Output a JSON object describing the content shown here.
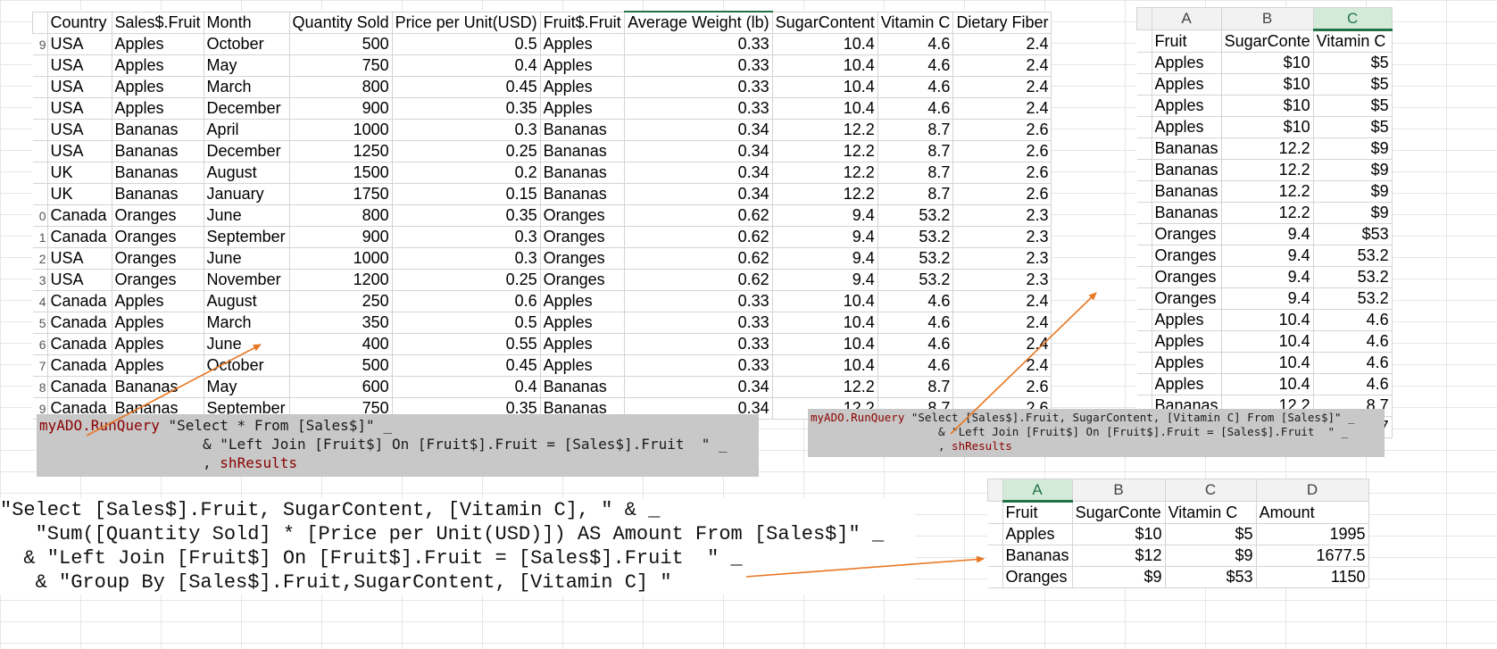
{
  "sales_table": {
    "headers": [
      "Country",
      "Sales$.Fruit",
      "Month",
      "Quantity Sold",
      "Price per Unit(USD)",
      "Fruit$.Fruit",
      "Average Weight (lb)",
      "SugarContent",
      "Vitamin C",
      "Dietary Fiber"
    ],
    "row_numbers": [
      "9",
      "",
      "",
      "",
      "",
      "",
      "",
      "",
      "0",
      "1",
      "2",
      "3",
      "4",
      "5",
      "6",
      "7",
      "8",
      "9"
    ],
    "rows": [
      [
        "USA",
        "Apples",
        "October",
        "500",
        "0.5",
        "Apples",
        "0.33",
        "10.4",
        "4.6",
        "2.4"
      ],
      [
        "USA",
        "Apples",
        "May",
        "750",
        "0.4",
        "Apples",
        "0.33",
        "10.4",
        "4.6",
        "2.4"
      ],
      [
        "USA",
        "Apples",
        "March",
        "800",
        "0.45",
        "Apples",
        "0.33",
        "10.4",
        "4.6",
        "2.4"
      ],
      [
        "USA",
        "Apples",
        "December",
        "900",
        "0.35",
        "Apples",
        "0.33",
        "10.4",
        "4.6",
        "2.4"
      ],
      [
        "USA",
        "Bananas",
        "April",
        "1000",
        "0.3",
        "Bananas",
        "0.34",
        "12.2",
        "8.7",
        "2.6"
      ],
      [
        "USA",
        "Bananas",
        "December",
        "1250",
        "0.25",
        "Bananas",
        "0.34",
        "12.2",
        "8.7",
        "2.6"
      ],
      [
        "UK",
        "Bananas",
        "August",
        "1500",
        "0.2",
        "Bananas",
        "0.34",
        "12.2",
        "8.7",
        "2.6"
      ],
      [
        "UK",
        "Bananas",
        "January",
        "1750",
        "0.15",
        "Bananas",
        "0.34",
        "12.2",
        "8.7",
        "2.6"
      ],
      [
        "Canada",
        "Oranges",
        "June",
        "800",
        "0.35",
        "Oranges",
        "0.62",
        "9.4",
        "53.2",
        "2.3"
      ],
      [
        "Canada",
        "Oranges",
        "September",
        "900",
        "0.3",
        "Oranges",
        "0.62",
        "9.4",
        "53.2",
        "2.3"
      ],
      [
        "USA",
        "Oranges",
        "June",
        "1000",
        "0.3",
        "Oranges",
        "0.62",
        "9.4",
        "53.2",
        "2.3"
      ],
      [
        "USA",
        "Oranges",
        "November",
        "1200",
        "0.25",
        "Oranges",
        "0.62",
        "9.4",
        "53.2",
        "2.3"
      ],
      [
        "Canada",
        "Apples",
        "August",
        "250",
        "0.6",
        "Apples",
        "0.33",
        "10.4",
        "4.6",
        "2.4"
      ],
      [
        "Canada",
        "Apples",
        "March",
        "350",
        "0.5",
        "Apples",
        "0.33",
        "10.4",
        "4.6",
        "2.4"
      ],
      [
        "Canada",
        "Apples",
        "June",
        "400",
        "0.55",
        "Apples",
        "0.33",
        "10.4",
        "4.6",
        "2.4"
      ],
      [
        "Canada",
        "Apples",
        "October",
        "500",
        "0.45",
        "Apples",
        "0.33",
        "10.4",
        "4.6",
        "2.4"
      ],
      [
        "Canada",
        "Bananas",
        "May",
        "600",
        "0.4",
        "Bananas",
        "0.34",
        "12.2",
        "8.7",
        "2.6"
      ],
      [
        "Canada",
        "Bananas",
        "September",
        "750",
        "0.35",
        "Bananas",
        "0.34",
        "12.2",
        "8.7",
        "2.6"
      ]
    ]
  },
  "subset_table": {
    "col_letters": [
      "A",
      "B",
      "C"
    ],
    "headers": [
      "Fruit",
      "SugarConte",
      "Vitamin C"
    ],
    "rows": [
      [
        "Apples",
        "$10",
        "$5"
      ],
      [
        "Apples",
        "$10",
        "$5"
      ],
      [
        "Apples",
        "$10",
        "$5"
      ],
      [
        "Apples",
        "$10",
        "$5"
      ],
      [
        "Bananas",
        "12.2",
        "$9"
      ],
      [
        "Bananas",
        "12.2",
        "$9"
      ],
      [
        "Bananas",
        "12.2",
        "$9"
      ],
      [
        "Bananas",
        "12.2",
        "$9"
      ],
      [
        "Oranges",
        "9.4",
        "$53"
      ],
      [
        "Oranges",
        "9.4",
        "53.2"
      ],
      [
        "Oranges",
        "9.4",
        "53.2"
      ],
      [
        "Oranges",
        "9.4",
        "53.2"
      ],
      [
        "Apples",
        "10.4",
        "4.6"
      ],
      [
        "Apples",
        "10.4",
        "4.6"
      ],
      [
        "Apples",
        "10.4",
        "4.6"
      ],
      [
        "Apples",
        "10.4",
        "4.6"
      ],
      [
        "Bananas",
        "12.2",
        "8.7"
      ],
      [
        "Bananas",
        "12.2",
        "8.7"
      ]
    ]
  },
  "grouped_table": {
    "col_letters": [
      "A",
      "B",
      "C",
      "D"
    ],
    "headers": [
      "Fruit",
      "SugarConte",
      "Vitamin C",
      "Amount"
    ],
    "rows": [
      [
        "Apples",
        "$10",
        "$5",
        "1995"
      ],
      [
        "Bananas",
        "$12",
        "$9",
        "1677.5"
      ],
      [
        "Oranges",
        "$9",
        "$53",
        "1150"
      ]
    ]
  },
  "code_box_1": {
    "line1_kw": "myADO.RunQuery",
    "line1_rest": " \"Select * From [Sales$]\" _",
    "line2": "                   & \"Left Join [Fruit$] On [Fruit$].Fruit = [Sales$].Fruit  \" _",
    "line3_prefix": "                   , ",
    "line3_kw": "shResults"
  },
  "code_box_2": {
    "line1_kw": "myADO.RunQuery",
    "line1_rest": " \"Select [Sales$].Fruit, SugarContent, [Vitamin C] From [Sales$]\" _",
    "line2": "                   & \"Left Join [Fruit$] On [Fruit$].Fruit = [Sales$].Fruit  \" _",
    "line3_prefix": "                   , ",
    "line3_kw": "shResults"
  },
  "big_code": {
    "lines": [
      "\"Select [Sales$].Fruit, SugarContent, [Vitamin C], \" & _",
      "   \"Sum([Quantity Sold] * [Price per Unit(USD)]) AS Amount From [Sales$]\" _",
      "  & \"Left Join [Fruit$] On [Fruit$].Fruit = [Sales$].Fruit  \" _",
      "   & \"Group By [Sales$].Fruit,SugarContent, [Vitamin C] \""
    ]
  },
  "colors": {
    "arrow": "#e87722",
    "code_bg": "#c8c8c8",
    "keyword": "#8b0000",
    "excel_green": "#217346"
  }
}
